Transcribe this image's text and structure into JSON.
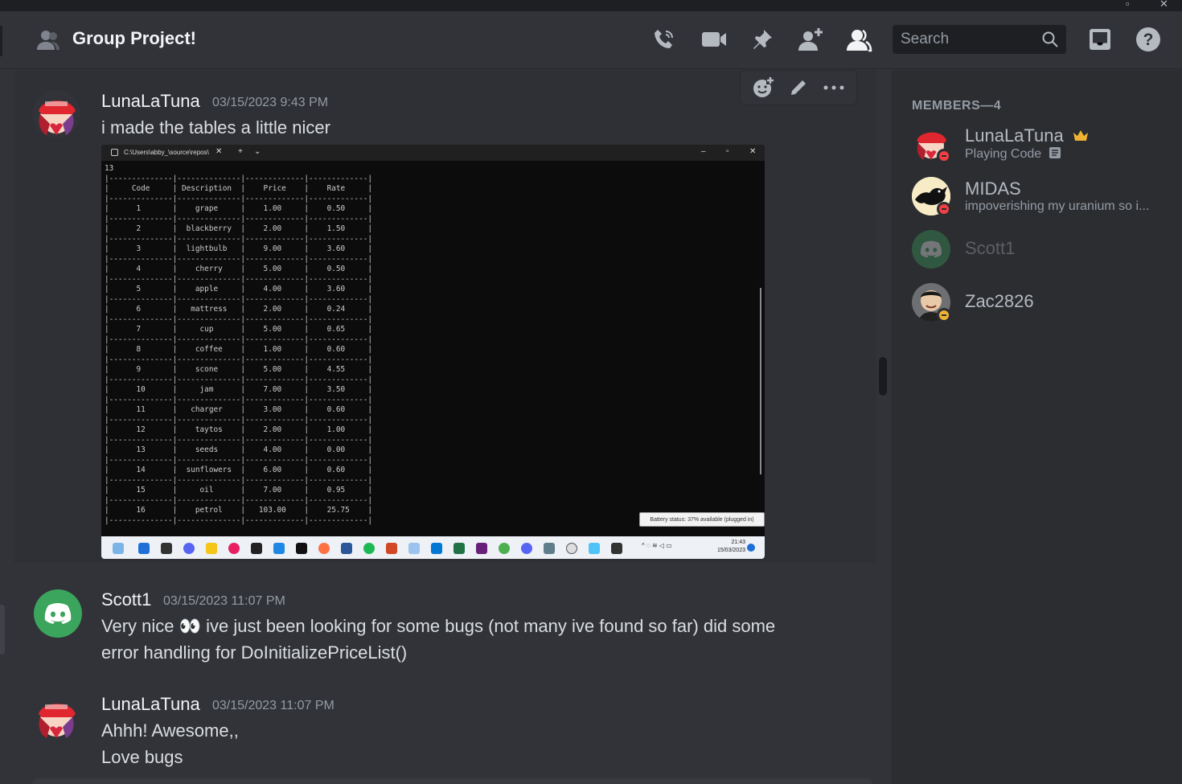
{
  "header": {
    "title": "Group Project!",
    "search_placeholder": "Search"
  },
  "messages": [
    {
      "author": "LunaLaTuna",
      "timestamp": "03/15/2023 9:43 PM",
      "lines": [
        "i made the tables a little nicer"
      ]
    },
    {
      "author": "Scott1",
      "timestamp": "03/15/2023 11:07 PM",
      "lines": [
        "Very nice 👀 ive just been looking for some bugs (not many ive found so far) did some",
        "error handling for DoInitializePriceList()"
      ]
    },
    {
      "author": "LunaLaTuna",
      "timestamp": "03/15/2023 11:07 PM",
      "lines": [
        "Ahhh! Awesome,,",
        "Love bugs"
      ]
    }
  ],
  "attachment": {
    "tab_title": "C:\\Users\\abby_\\source\\repos\\",
    "first_line": "13",
    "headers": [
      "Code",
      "Description",
      "Price",
      "Rate"
    ],
    "rows": [
      [
        "1",
        "grape",
        "1.00",
        "0.50"
      ],
      [
        "2",
        "blackberry",
        "2.00",
        "1.50"
      ],
      [
        "3",
        "lightbulb",
        "9.00",
        "3.60"
      ],
      [
        "4",
        "cherry",
        "5.00",
        "0.50"
      ],
      [
        "5",
        "apple",
        "4.00",
        "3.60"
      ],
      [
        "6",
        "mattress",
        "2.00",
        "0.24"
      ],
      [
        "7",
        "cup",
        "5.00",
        "0.65"
      ],
      [
        "8",
        "coffee",
        "1.00",
        "0.60"
      ],
      [
        "9",
        "scone",
        "5.00",
        "4.55"
      ],
      [
        "10",
        "jam",
        "7.00",
        "3.50"
      ],
      [
        "11",
        "charger",
        "3.00",
        "0.60"
      ],
      [
        "12",
        "taytos",
        "2.00",
        "1.00"
      ],
      [
        "13",
        "seeds",
        "4.00",
        "0.00"
      ],
      [
        "14",
        "sunflowers",
        "6.00",
        "0.60"
      ],
      [
        "15",
        "oil",
        "7.00",
        "0.95"
      ],
      [
        "16",
        "petrol",
        "103.00",
        "25.75"
      ]
    ],
    "battery_status": "Battery status: 37% available (plugged in)",
    "tray_time": "21:43",
    "tray_date": "15/03/2023"
  },
  "members": {
    "heading": "MEMBERS—4",
    "list": [
      {
        "name": "LunaLaTuna",
        "status": "Playing Code",
        "owner": true,
        "presence": "dnd"
      },
      {
        "name": "MIDAS",
        "status": "impoverishing my uranium so i...",
        "owner": false,
        "presence": "dnd"
      },
      {
        "name": "Scott1",
        "status": "",
        "owner": false,
        "presence": "offline"
      },
      {
        "name": "Zac2826",
        "status": "",
        "owner": false,
        "presence": "idle"
      }
    ]
  },
  "colors": {
    "background": "#313338",
    "sidebar": "#2b2d31",
    "discord_green": "#3ba55d",
    "dnd_red": "#f23f43",
    "idle_yellow": "#f0b232"
  }
}
